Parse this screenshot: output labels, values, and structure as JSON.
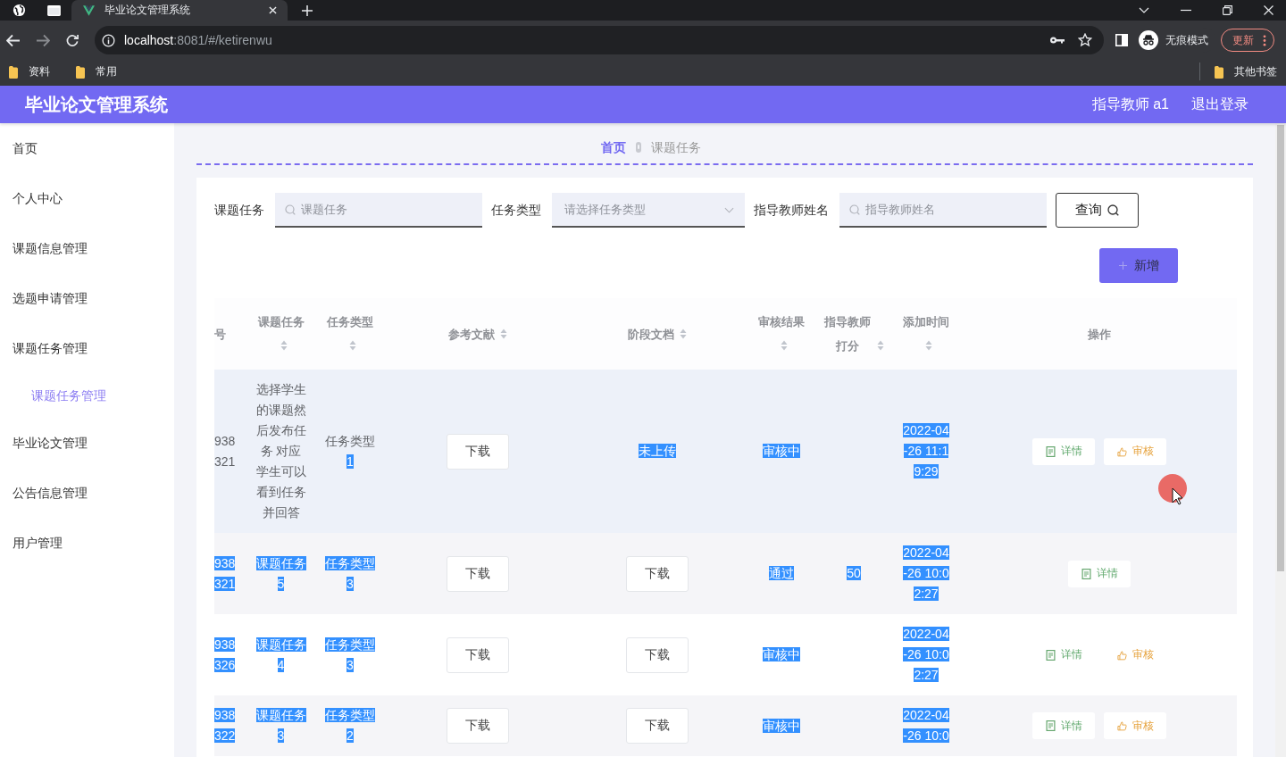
{
  "browser": {
    "tab_title": "毕业论文管理系统",
    "url_host": "localhost",
    "url_path": ":8081/#/ketirenwu",
    "profile_label": "无痕模式",
    "update_label": "更新",
    "bookmarks": [
      "资料",
      "常用"
    ],
    "other_bookmarks": "其他书签"
  },
  "header": {
    "title": "毕业论文管理系统",
    "user": "指导教师 a1",
    "logout": "退出登录"
  },
  "sidebar": {
    "items": [
      {
        "label": "首页",
        "selected": false
      },
      {
        "label": "个人中心",
        "selected": false
      },
      {
        "label": "课题信息管理",
        "selected": false
      },
      {
        "label": "选题申请管理",
        "selected": false
      },
      {
        "label": "课题任务管理",
        "selected": false,
        "children": [
          {
            "label": "课题任务管理",
            "selected": true
          }
        ]
      },
      {
        "label": "毕业论文管理",
        "selected": false
      },
      {
        "label": "公告信息管理",
        "selected": false
      },
      {
        "label": "用户管理",
        "selected": false
      }
    ]
  },
  "breadcrumb": [
    "首页",
    "课题任务"
  ],
  "filters": [
    {
      "kind": "input",
      "label": "课题任务",
      "placeholder": "课题任务"
    },
    {
      "kind": "select",
      "label": "任务类型",
      "placeholder": "请选择任务类型"
    },
    {
      "kind": "input",
      "label": "指导教师姓名",
      "placeholder": "指导教师姓名"
    }
  ],
  "search_button": "查询",
  "add_button": "新增",
  "table": {
    "columns": [
      {
        "label": "号",
        "sortable": false
      },
      {
        "label": "课题任务",
        "sortable": true
      },
      {
        "label": "任务类型",
        "sortable": true
      },
      {
        "label": "参考文献",
        "sortable": true
      },
      {
        "label": "阶段文档",
        "sortable": true
      },
      {
        "label": "审核结果",
        "sortable": true
      },
      {
        "label": "指导教师打分",
        "sortable": true
      },
      {
        "label": "添加时间",
        "sortable": true
      },
      {
        "label": "操作",
        "sortable": false
      }
    ],
    "rows": [
      {
        "hovered": true,
        "id": [
          {
            "text": "938321",
            "highlighted": false
          }
        ],
        "task": [
          {
            "text": "选择学生的课题然后发布任务 对应学生可以看到任务并回答",
            "highlighted": false
          }
        ],
        "type": [
          {
            "text": "任务类型",
            "highlighted": false
          },
          {
            "text": "1",
            "highlighted": true
          }
        ],
        "reference": "下载",
        "stage_doc": {
          "kind": "text",
          "runs": [
            {
              "text": "未上传",
              "highlighted": true
            }
          ]
        },
        "review": [
          {
            "text": "审核中",
            "highlighted": true
          }
        ],
        "time": [
          {
            "text": "2022-04-26 11:19:29",
            "highlighted": true
          }
        ],
        "actions": [
          {
            "kind": "detail",
            "label": "详情"
          },
          {
            "kind": "review",
            "label": "审核"
          }
        ]
      },
      {
        "hovered": false,
        "id": [
          {
            "text": "938321",
            "highlighted": true
          }
        ],
        "task": [
          {
            "text": "课题任务5",
            "highlighted": true
          }
        ],
        "type": [
          {
            "text": "任务类型3",
            "highlighted": true
          }
        ],
        "reference": "下载",
        "stage_doc": {
          "kind": "button",
          "label": "下载"
        },
        "review": [
          {
            "text": "通过",
            "highlighted": true
          }
        ],
        "score": [
          {
            "text": "50",
            "highlighted": true
          }
        ],
        "time": [
          {
            "text": "2022-04-26 10:02:27",
            "highlighted": true
          }
        ],
        "actions": [
          {
            "kind": "detail",
            "label": "详情"
          }
        ]
      },
      {
        "hovered": false,
        "id": [
          {
            "text": "938326",
            "highlighted": true
          }
        ],
        "task": [
          {
            "text": "课题任务4",
            "highlighted": true
          }
        ],
        "type": [
          {
            "text": "任务类型3",
            "highlighted": true
          }
        ],
        "reference": "下载",
        "stage_doc": {
          "kind": "button",
          "label": "下载"
        },
        "review": [
          {
            "text": "审核中",
            "highlighted": true
          }
        ],
        "time": [
          {
            "text": "2022-04-26 10:02:27",
            "highlighted": true
          }
        ],
        "actions": [
          {
            "kind": "detail",
            "label": "详情"
          },
          {
            "kind": "review",
            "label": "审核"
          }
        ]
      },
      {
        "hovered": false,
        "id": [
          {
            "text": "938322",
            "highlighted": true
          }
        ],
        "task": [
          {
            "text": "课题任务3",
            "highlighted": true
          }
        ],
        "type": [
          {
            "text": "任务类型2",
            "highlighted": true
          }
        ],
        "reference": "下载",
        "stage_doc": {
          "kind": "button",
          "label": "下载"
        },
        "review": [
          {
            "text": "审核中",
            "highlighted": true
          }
        ],
        "time": [
          {
            "text": "2022-04-26 10:0",
            "highlighted": true
          }
        ],
        "actions": [
          {
            "kind": "detail",
            "label": "详情"
          },
          {
            "kind": "review",
            "label": "审核"
          }
        ]
      }
    ]
  }
}
